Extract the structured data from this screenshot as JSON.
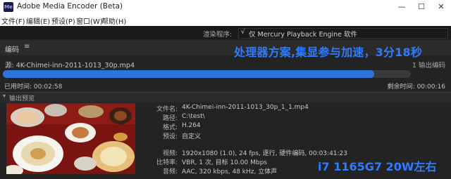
{
  "window": {
    "title": "Adobe Media Encoder (Beta)",
    "app_icon": "Me"
  },
  "menu": [
    "文件(F)",
    "编辑(E)",
    "预设(P)",
    "窗口(W)",
    "帮助(H)"
  ],
  "render": {
    "label": "渲染程序:",
    "check": "√",
    "value": "仅 Mercury Playback Engine 软件"
  },
  "encode": {
    "label": "编码",
    "menu_glyph": "≡"
  },
  "overlay_top": "处理器方案,集显参与加速，3分18秒",
  "job": {
    "source": "源: 4K-Chimei-inn-2011-1013_30p.mp4",
    "outputs": "1 输出编码",
    "progress": 0.91,
    "elapsed_label": "已用时间: 00:02:58",
    "remaining_label": "剩余时间: 00:00:16"
  },
  "preview": {
    "arrow": "▾",
    "label": "输出预览"
  },
  "details": {
    "filename_label": "文件名:",
    "filename": "4K-Chimei-inn-2011-1013_30p_1_1.mp4",
    "path_label": "路径:",
    "path": "C:\\test\\",
    "format_label": "格式:",
    "format": "H.264",
    "preset_label": "预设:",
    "preset": "自定义",
    "video_label": "视频:",
    "video": "1920x1080 (1.0), 24 fps, 逐行, 硬件编码, 00:03:41:23",
    "bitrate_label": "比特率:",
    "bitrate": "VBR, 1 次, 目标 10.00 Mbps",
    "audio_label": "音频:",
    "audio": "AAC, 320 kbps, 48 kHz, 立体声"
  },
  "overlay_bottom": "i7 1165G7 20W左右",
  "colors": {
    "accent": "#2b74d8",
    "overlay_text": "#2f7bff",
    "background": "#232323"
  }
}
